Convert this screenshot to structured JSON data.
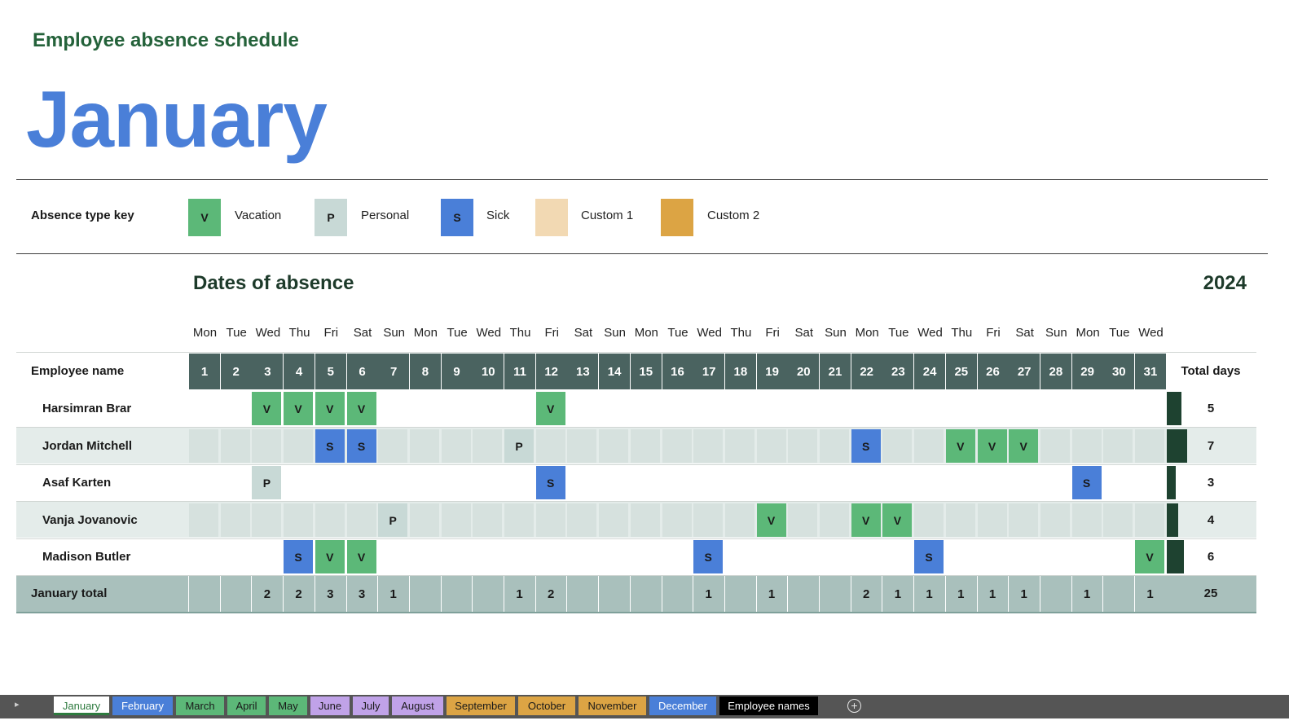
{
  "header": {
    "subtitle": "Employee absence schedule",
    "month": "January"
  },
  "key": {
    "label": "Absence type key",
    "items": [
      {
        "code": "V",
        "label": "Vacation",
        "color": "#5cb878"
      },
      {
        "code": "P",
        "label": "Personal",
        "color": "#c8d9d6"
      },
      {
        "code": "S",
        "label": "Sick",
        "color": "#4a7fd8"
      },
      {
        "code": "",
        "label": "Custom 1",
        "color": "#f2d9b3"
      },
      {
        "code": "",
        "label": "Custom 2",
        "color": "#dca444"
      }
    ]
  },
  "section": {
    "title": "Dates of absence",
    "year": "2024"
  },
  "grid": {
    "name_header": "Employee name",
    "total_header": "Total days",
    "weekdays": [
      "Mon",
      "Tue",
      "Wed",
      "Thu",
      "Fri",
      "Sat",
      "Sun",
      "Mon",
      "Tue",
      "Wed",
      "Thu",
      "Fri",
      "Sat",
      "Sun",
      "Mon",
      "Tue",
      "Wed",
      "Thu",
      "Fri",
      "Sat",
      "Sun",
      "Mon",
      "Tue",
      "Wed",
      "Thu",
      "Fri",
      "Sat",
      "Sun",
      "Mon",
      "Tue",
      "Wed"
    ],
    "days": [
      "1",
      "2",
      "3",
      "4",
      "5",
      "6",
      "7",
      "8",
      "9",
      "10",
      "11",
      "12",
      "13",
      "14",
      "15",
      "16",
      "17",
      "18",
      "19",
      "20",
      "21",
      "22",
      "23",
      "24",
      "25",
      "26",
      "27",
      "28",
      "29",
      "30",
      "31"
    ],
    "employees": [
      {
        "name": "Harsimran Brar",
        "absences": {
          "3": "V",
          "4": "V",
          "5": "V",
          "6": "V",
          "12": "V"
        },
        "total": "5",
        "total_value": 5
      },
      {
        "name": "Jordan Mitchell",
        "absences": {
          "5": "S",
          "6": "S",
          "11": "P",
          "22": "S",
          "25": "V",
          "26": "V",
          "27": "V"
        },
        "total": "7",
        "total_value": 7
      },
      {
        "name": "Asaf Karten",
        "absences": {
          "3": "P",
          "12": "S",
          "29": "S"
        },
        "total": "3",
        "total_value": 3
      },
      {
        "name": "Vanja Jovanovic",
        "absences": {
          "7": "P",
          "19": "V",
          "22": "V",
          "23": "V"
        },
        "total": "4",
        "total_value": 4
      },
      {
        "name": "Madison Butler",
        "absences": {
          "4": "S",
          "5": "V",
          "6": "V",
          "17": "S",
          "24": "S",
          "31": "V"
        },
        "total": "6",
        "total_value": 6
      }
    ],
    "total_row": {
      "label": "January total",
      "values": [
        "",
        "",
        "2",
        "2",
        "3",
        "3",
        "1",
        "",
        "",
        "",
        "1",
        "2",
        "",
        "",
        "",
        "",
        "1",
        "",
        "1",
        "",
        "",
        "2",
        "1",
        "1",
        "1",
        "1",
        "1",
        "",
        "1",
        "",
        "1"
      ],
      "grand_total": "25"
    },
    "colors": {
      "day_header": "#4a6360",
      "row_alt": "#e4ecea",
      "cell_empty_alt": "#d6e1de",
      "total_row": "#a9c0bc",
      "bar": "#1e4230"
    }
  },
  "tabs": {
    "items": [
      {
        "label": "January",
        "color": "#ffffff",
        "active": true
      },
      {
        "label": "February",
        "color": "#4a7fd8",
        "active": false
      },
      {
        "label": "March",
        "color": "#5cb878",
        "active": false
      },
      {
        "label": "April",
        "color": "#5cb878",
        "active": false
      },
      {
        "label": "May",
        "color": "#5cb878",
        "active": false
      },
      {
        "label": "June",
        "color": "#c0a2e8",
        "active": false
      },
      {
        "label": "July",
        "color": "#c0a2e8",
        "active": false
      },
      {
        "label": "August",
        "color": "#c0a2e8",
        "active": false
      },
      {
        "label": "September",
        "color": "#dca444",
        "active": false
      },
      {
        "label": "October",
        "color": "#dca444",
        "active": false
      },
      {
        "label": "November",
        "color": "#dca444",
        "active": false
      },
      {
        "label": "December",
        "color": "#4a7fd8",
        "active": false
      },
      {
        "label": "Employee names",
        "color": "#000000",
        "active": false
      }
    ],
    "add_symbol": "+"
  }
}
